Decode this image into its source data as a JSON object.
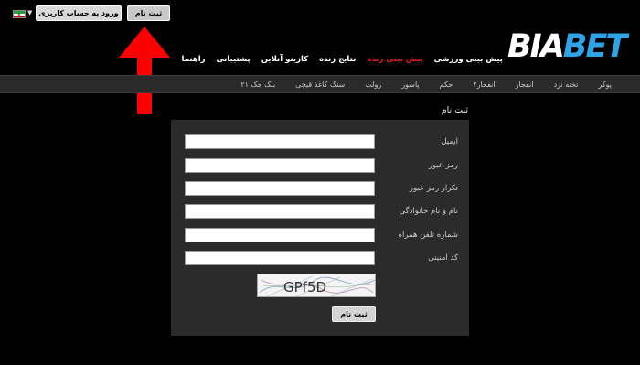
{
  "topbar": {
    "login_label": "ورود به حساب کاربری",
    "register_label": "ثبت نام",
    "language_flag": "iran-flag-icon"
  },
  "logo": {
    "part1": "BIA",
    "part2": "BET"
  },
  "main_nav": [
    {
      "label": "پیش بینی ورزشی",
      "active": false
    },
    {
      "label": "پیش بینی زنده",
      "active": true
    },
    {
      "label": "نتایج زنده",
      "active": false
    },
    {
      "label": "کازینو آنلاین",
      "active": false
    },
    {
      "label": "پشتیبانی",
      "active": false
    },
    {
      "label": "راهنما",
      "active": false
    }
  ],
  "sub_nav": [
    "پوکر",
    "تخته نرد",
    "انفجار",
    "انفجار۲",
    "حکم",
    "پاسور",
    "رولت",
    "سنگ کاغذ قیچی",
    "بلک جک ۲۱"
  ],
  "page": {
    "title": "ثبت نام"
  },
  "form": {
    "email_label": "ایمیل",
    "password_label": "رمز عبور",
    "password_repeat_label": "تکرار رمز عبور",
    "fullname_label": "نام و نام خانوادگی",
    "phone_label": "شماره تلفن همراه",
    "security_code_label": "کد امنیتی",
    "captcha_text": "GPf5D",
    "submit_label": "ثبت نام"
  },
  "colors": {
    "accent_blue": "#2ea3e8",
    "active_red": "#e31c1c",
    "arrow_red": "#ff0000"
  }
}
